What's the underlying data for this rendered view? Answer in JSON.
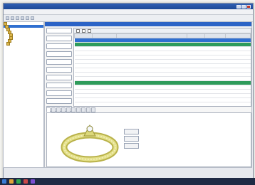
{
  "window": {
    "title": "",
    "close_label": "x"
  },
  "menu": [
    "",
    "",
    "",
    "",
    "",
    "",
    "",
    "",
    ""
  ],
  "tree": [
    "",
    "",
    "",
    "",
    "",
    "",
    "",
    ""
  ],
  "main_header": "",
  "side_buttons": [
    "",
    "",
    "",
    "",
    "",
    "",
    "",
    "",
    "",
    "",
    "",
    ""
  ],
  "grid": {
    "columns": [
      "",
      "",
      "",
      "",
      "",
      ""
    ],
    "rows": [
      {
        "kind": "blue",
        "cells": [
          "",
          "",
          "",
          "",
          "",
          ""
        ]
      },
      {
        "kind": "green",
        "cells": [
          "",
          "",
          "",
          "",
          "",
          ""
        ]
      },
      {
        "kind": "",
        "cells": [
          "",
          "",
          "",
          "",
          "",
          ""
        ]
      },
      {
        "kind": "",
        "cells": [
          "",
          "",
          "",
          "",
          "",
          ""
        ]
      },
      {
        "kind": "",
        "cells": [
          "",
          "",
          "",
          "",
          "",
          ""
        ]
      },
      {
        "kind": "",
        "cells": [
          "",
          "",
          "",
          "",
          "",
          ""
        ]
      },
      {
        "kind": "",
        "cells": [
          "",
          "",
          "",
          "",
          "",
          ""
        ]
      },
      {
        "kind": "",
        "cells": [
          "",
          "",
          "",
          "",
          "",
          ""
        ]
      },
      {
        "kind": "",
        "cells": [
          "",
          "",
          "",
          "",
          "",
          ""
        ]
      },
      {
        "kind": "",
        "cells": [
          "",
          "",
          "",
          "",
          "",
          ""
        ]
      },
      {
        "kind": "green",
        "cells": [
          "",
          "",
          "",
          "",
          "",
          ""
        ]
      },
      {
        "kind": "",
        "cells": [
          "",
          "",
          "",
          "",
          "",
          ""
        ]
      },
      {
        "kind": "",
        "cells": [
          "",
          "",
          "",
          "",
          "",
          ""
        ]
      },
      {
        "kind": "",
        "cells": [
          "",
          "",
          "",
          "",
          "",
          ""
        ]
      },
      {
        "kind": "",
        "cells": [
          "",
          "",
          "",
          "",
          "",
          ""
        ]
      }
    ]
  },
  "tabs": [
    "",
    "",
    "",
    "",
    "",
    "",
    "",
    "",
    "",
    ""
  ],
  "detail_buttons": [
    "",
    "",
    ""
  ],
  "clock": "",
  "colors": {
    "accent": "#2b63c6",
    "ring_gold": "#d9d46a",
    "green_row": "#2e9b5b"
  }
}
